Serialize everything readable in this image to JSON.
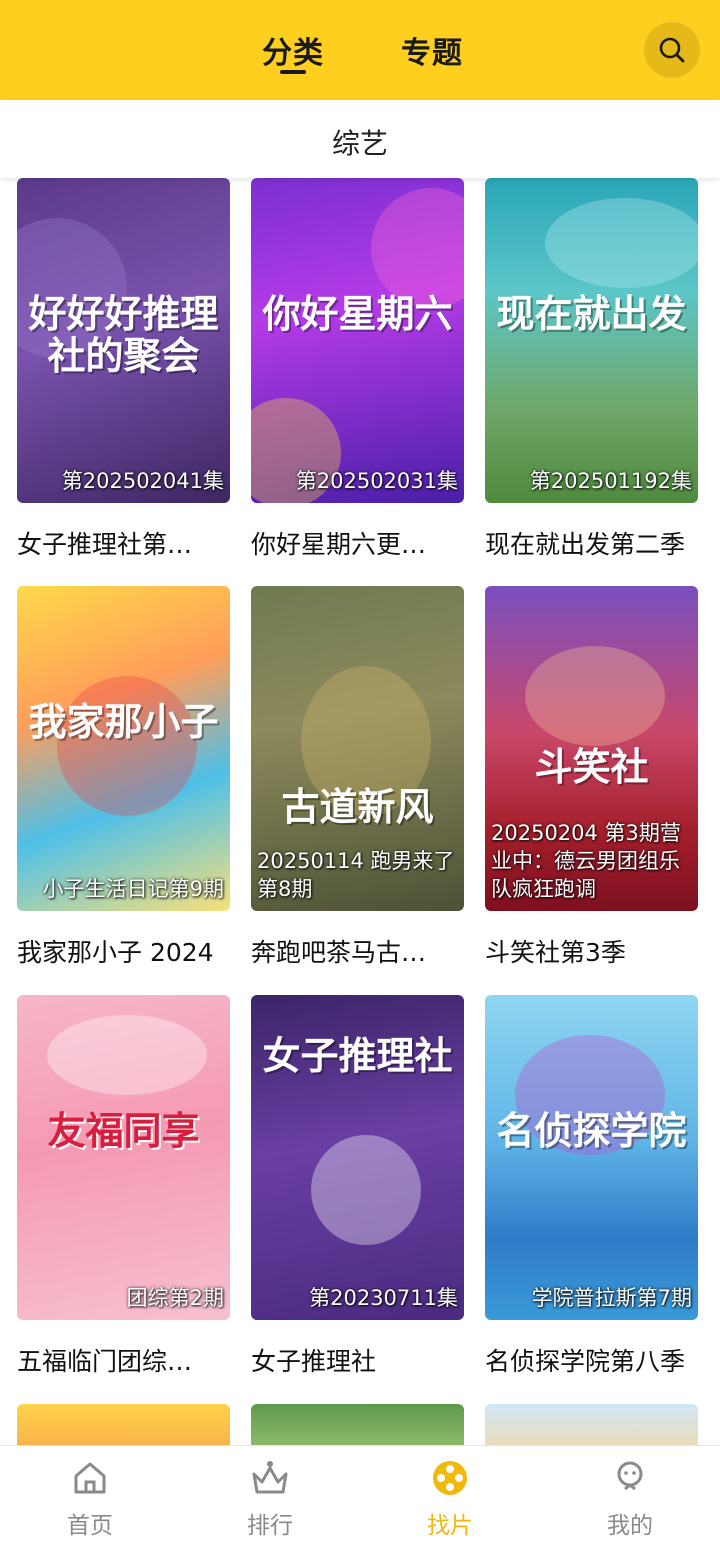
{
  "header": {
    "tabs": [
      {
        "label": "分类",
        "active": true
      },
      {
        "label": "专题",
        "active": false
      }
    ],
    "search_icon": "search-icon",
    "accent_color": "#ffcf1f"
  },
  "subbar": {
    "label": "综艺"
  },
  "items": [
    {
      "title": "女子推理社第…",
      "poster_text": "好好好推理社的聚会",
      "badge": "第202502041集"
    },
    {
      "title": "你好星期六更…",
      "poster_text": "你好星期六",
      "badge": "第202502031集"
    },
    {
      "title": "现在就出发第二季",
      "poster_text": "现在就出发",
      "badge": "第202501192集"
    },
    {
      "title": "我家那小子 2024",
      "poster_text": "我家那小子",
      "badge": "小子生活日记第9期"
    },
    {
      "title": "奔跑吧茶马古…",
      "poster_text": "古道新风",
      "badge": "20250114 跑男来了第8期"
    },
    {
      "title": "斗笑社第3季",
      "poster_text": "斗笑社",
      "badge": "20250204 第3期营业中：德云男团组乐队疯狂跑调"
    },
    {
      "title": "五福临门团综…",
      "poster_text": "友福同享",
      "badge": "团综第2期"
    },
    {
      "title": "女子推理社",
      "poster_text": "女子推理社",
      "badge": "第20230711集"
    },
    {
      "title": "名侦探学院第八季",
      "poster_text": "名侦探学院",
      "badge": "学院普拉斯第7期"
    }
  ],
  "bottom_nav": [
    {
      "label": "首页",
      "icon": "home-icon",
      "active": false
    },
    {
      "label": "排行",
      "icon": "crown-icon",
      "active": false
    },
    {
      "label": "找片",
      "icon": "film-reel-icon",
      "active": true
    },
    {
      "label": "我的",
      "icon": "profile-icon",
      "active": false
    }
  ],
  "colors": {
    "active_nav": "#f0b90b",
    "inactive_nav": "#8a8a8a"
  }
}
